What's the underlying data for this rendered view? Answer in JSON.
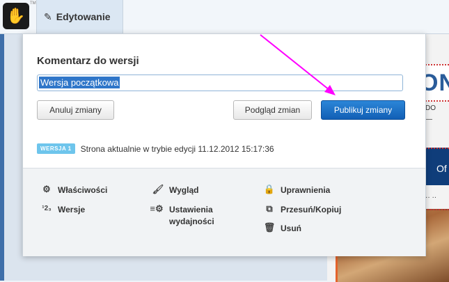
{
  "toolbar": {
    "edit_tab_label": "Edytowanie"
  },
  "panel": {
    "title": "Komentarz do wersji",
    "version_input_value": "Wersja początkowa",
    "buttons": {
      "cancel": "Anuluj zmiany",
      "preview": "Podgląd zmian",
      "publish": "Publikuj zmiany"
    },
    "status": {
      "badge": "WERSJA 1",
      "text": "Strona aktualnie w trybie edycji 11.12.2012 15:17:36"
    },
    "menu": {
      "properties": "Właściwości",
      "versions": "Wersje",
      "appearance": "Wygląd",
      "performance": "Ustawienia wydajności",
      "performance_line1": "Ustawienia",
      "performance_line2": "wydajności",
      "permissions": "Uprawnienia",
      "move_copy": "Przesuń/Kopiuj",
      "delete": "Usuń"
    }
  },
  "background_site": {
    "big_letters": "ON",
    "blue_button_text": "Of"
  },
  "colors": {
    "primary_button": "#1a6fc8",
    "badge": "#6ec5ec",
    "annotation_arrow": "#ff00ff"
  }
}
